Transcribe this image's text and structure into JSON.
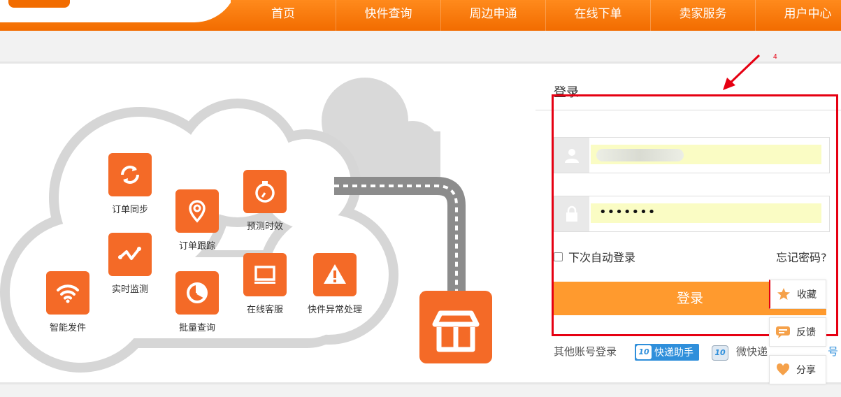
{
  "nav": {
    "items": [
      "首页",
      "快件查询",
      "周边申通",
      "在线下单",
      "卖家服务",
      "用户中心"
    ]
  },
  "features": [
    {
      "label": "订单同步",
      "icon": "sync-icon"
    },
    {
      "label": "实时监测",
      "icon": "monitor-pulse-icon"
    },
    {
      "label": "智能发件",
      "icon": "wifi-icon"
    },
    {
      "label": "订单跟踪",
      "icon": "location-pin-icon"
    },
    {
      "label": "批量查询",
      "icon": "pie-chart-icon"
    },
    {
      "label": "预测时效",
      "icon": "stopwatch-icon"
    },
    {
      "label": "在线客服",
      "icon": "monitor-icon"
    },
    {
      "label": "快件异常处理",
      "icon": "warning-icon"
    }
  ],
  "annotation": {
    "number": "4"
  },
  "login": {
    "title": "登录",
    "password_mask": "•••••••",
    "remember_label": "下次自动登录",
    "forgot_label": "忘记密码?",
    "submit_label": "登录",
    "other_label": "其他账号登录",
    "third_party_1": "快递助手",
    "third_party_2": "微快递",
    "trailing_char": "号"
  },
  "side_widget": {
    "favorite": "收藏",
    "feedback": "反馈",
    "share": "分享"
  },
  "colors": {
    "brand_orange": "#f26c00",
    "icon_orange": "#f46a27",
    "button_orange": "#ff9a2e",
    "annotation_red": "#e60012",
    "autofill_yellow": "#fafcc4"
  }
}
